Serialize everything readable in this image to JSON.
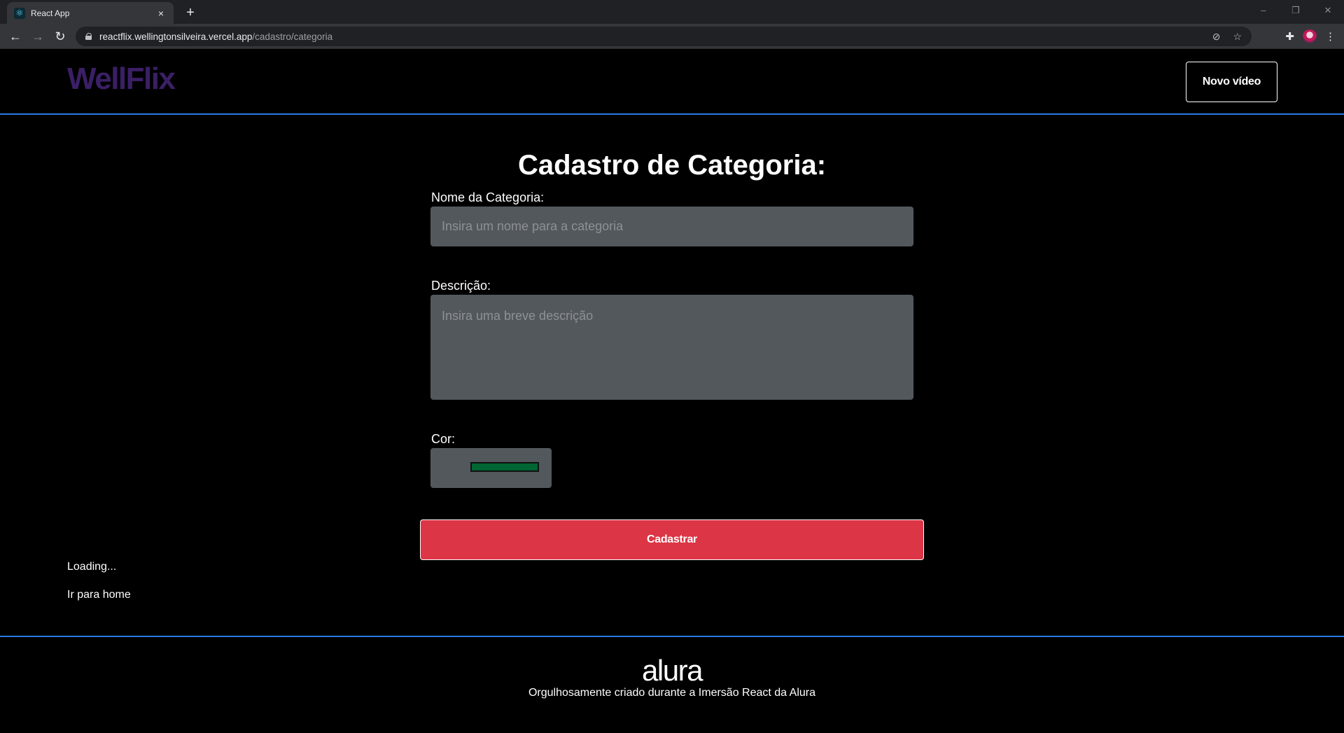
{
  "browser": {
    "tab_title": "React App",
    "tab_close": "×",
    "new_tab": "+",
    "url_host": "reactflix.wellingtonsilveira.vercel.app",
    "url_path": "/cadastro/categoria",
    "window_controls": {
      "minimize": "–",
      "restore": "❐",
      "close": "✕"
    },
    "nav": {
      "back": "←",
      "forward": "→",
      "reload": "↻"
    },
    "icons": {
      "tracking": "⊘",
      "star": "☆",
      "extensions": "✚",
      "menu": "⋮"
    }
  },
  "header": {
    "logo": "WellFlix",
    "new_video_button": "Novo vídeo"
  },
  "form": {
    "title": "Cadastro de Categoria:",
    "name_label": "Nome da Categoria:",
    "name_placeholder": "Insira um nome para a categoria",
    "description_label": "Descrição:",
    "description_placeholder": "Insira uma breve descrição",
    "color_label": "Cor:",
    "color_value": "#006633",
    "submit_button": "Cadastrar"
  },
  "status": {
    "loading": "Loading...",
    "home_link": "Ir para home"
  },
  "footer": {
    "logo": "alura",
    "text": "Orgulhosamente criado durante a Imersão React da Alura"
  },
  "colors": {
    "accent_line": "#2a7ae4",
    "submit_button": "#dc3545",
    "logo": "#3b1f66",
    "input_bg": "#53585d"
  }
}
